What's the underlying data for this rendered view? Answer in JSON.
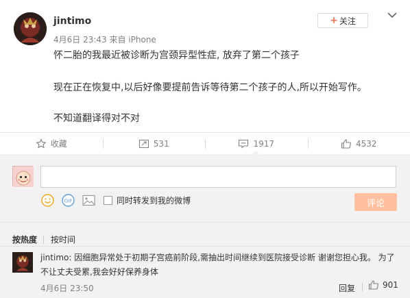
{
  "post": {
    "author": "jintimo",
    "meta": "4月6日 23:43 来自 iPhone",
    "follow_label": "关注",
    "lines": [
      "怀二胎的我最近被诊断为宫颈异型性症, 放弃了第二个孩子",
      "现在正在恢复中,以后好像要提前告诉等待第二个孩子的人,所以开始写作。",
      "不知道翻译得对不对"
    ]
  },
  "actions": {
    "favorite": "收藏",
    "repost": "531",
    "comment": "1917",
    "like": "4532"
  },
  "composer": {
    "sync_label": "同时转发到我的微博",
    "submit_label": "评论"
  },
  "sort": {
    "hot": "按热度",
    "time": "按时间"
  },
  "comment": {
    "user": "jintimo",
    "colon": ":",
    "text_line1": "因细胞异常处于初期子宫癌前阶段,需抽出时间继续到医院接受诊断 谢谢您担心我。 为了",
    "text_line2": "不让丈夫受累,我会好好保养身体",
    "time": "4月6日 23:50",
    "reply_label": "回复",
    "likes": "901"
  },
  "colors": {
    "accent": "#eb7350",
    "submit_disabled": "#ffc09f",
    "panel_bg": "#f2f2f5",
    "link": "#eb7350"
  }
}
